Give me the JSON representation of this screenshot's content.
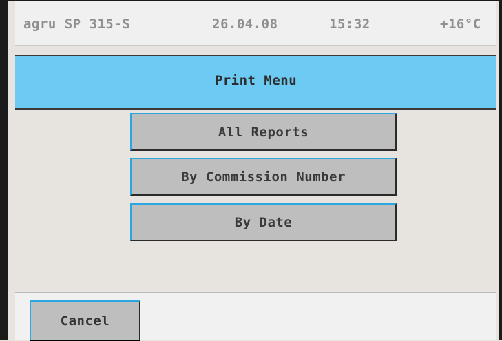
{
  "status": {
    "device": "agru SP 315-S",
    "date": "26.04.08",
    "time": "15:32",
    "temperature": "+16°C"
  },
  "title": "Print Menu",
  "menu": {
    "items": [
      {
        "label": "All Reports"
      },
      {
        "label": "By Commission Number"
      },
      {
        "label": "By Date"
      }
    ]
  },
  "footer": {
    "cancel_label": "Cancel"
  },
  "colors": {
    "title_bar": "#6dcaf2",
    "button_face": "#bebebe",
    "button_highlight": "#2aa6e0",
    "background": "#e7e4e0"
  }
}
